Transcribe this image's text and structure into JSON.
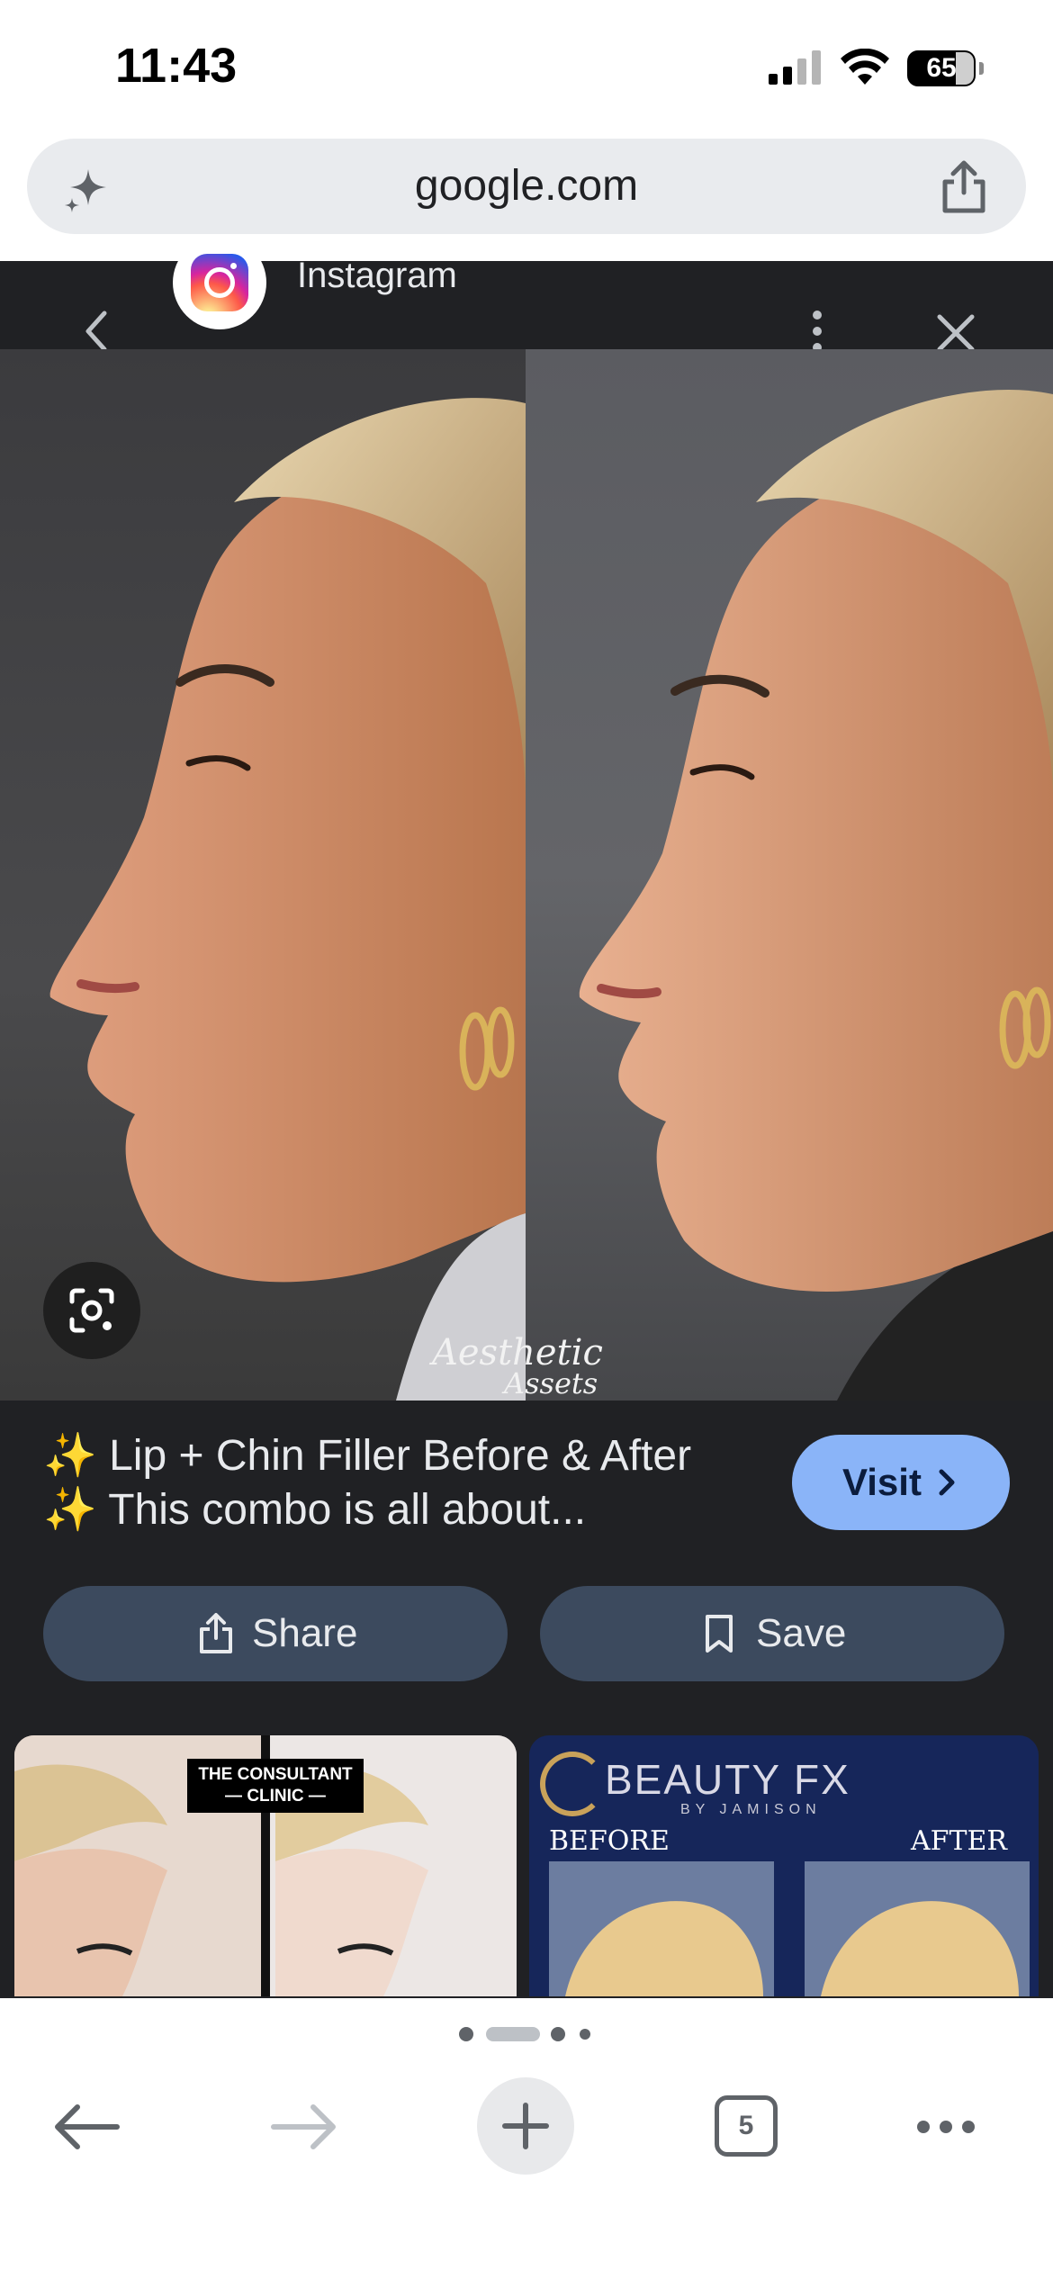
{
  "status_bar": {
    "time": "11:43",
    "battery": "65"
  },
  "url_bar": {
    "url": "google.com"
  },
  "viewer": {
    "source_name": "Instagram",
    "watermark_line1": "Aesthetic",
    "watermark_line2": "Assets",
    "caption_line1": "✨ Lip + Chin Filler Before & After",
    "caption_line2": "✨ This combo is all about...",
    "visit_label": "Visit",
    "share_label": "Share",
    "save_label": "Save"
  },
  "related": {
    "thumb_a_label_line1": "THE CONSULTANT",
    "thumb_a_label_line2": "— CLINIC —",
    "thumb_b_brand": "BEAUTY FX",
    "thumb_b_sub": "BY JAMISON",
    "thumb_b_before": "BEFORE",
    "thumb_b_after": "AFTER"
  },
  "pager": {
    "active_index": 1,
    "count": 4
  },
  "toolbar": {
    "tab_count": "5"
  },
  "colors": {
    "accent": "#8ab4f8",
    "viewer_bg": "#202124",
    "action_bg": "#3c4a5e"
  },
  "icons": [
    "sparkle-icon",
    "share-icon",
    "instagram-icon",
    "back-chevron-icon",
    "more-vert-icon",
    "close-icon",
    "lens-icon",
    "chevron-right-icon",
    "share-icon",
    "bookmark-icon",
    "back-arrow-icon",
    "forward-arrow-icon",
    "plus-icon",
    "more-horiz-icon"
  ]
}
